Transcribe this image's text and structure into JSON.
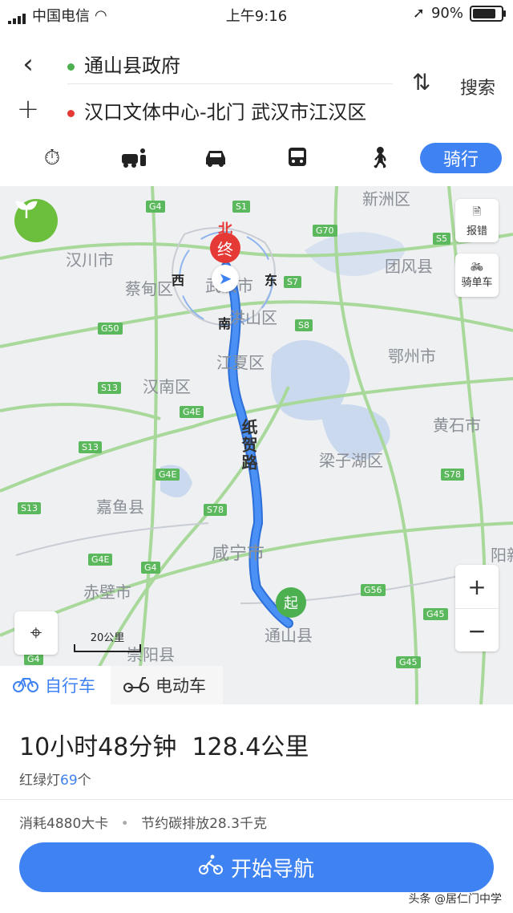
{
  "status_bar": {
    "carrier": "中国电信",
    "time": "上午9:16",
    "battery": "90%"
  },
  "route": {
    "origin": "通山县政府",
    "destination": "汉口文体中心-北门 武汉市江汉区",
    "search_label": "搜索"
  },
  "modes": [
    {
      "name": "taxi",
      "icon": "stopwatch-icon"
    },
    {
      "name": "ride-share",
      "icon": "car-people-icon"
    },
    {
      "name": "drive",
      "icon": "car-icon"
    },
    {
      "name": "bus",
      "icon": "bus-icon"
    },
    {
      "name": "walk",
      "icon": "walk-icon"
    },
    {
      "name": "cycle",
      "label": "骑行",
      "active": true
    }
  ],
  "map": {
    "labels": [
      "新洲区",
      "汉川市",
      "蔡甸区",
      "武汉市",
      "洪山区",
      "团风县",
      "鄂州市",
      "江夏区",
      "汉南区",
      "黄石市",
      "梁子湖区",
      "嘉鱼县",
      "咸宁市",
      "赤壁市",
      "崇阳县",
      "阳新",
      "通山县"
    ],
    "highways": [
      "G4",
      "S1",
      "G70",
      "S5",
      "S7",
      "G50",
      "S8",
      "S13",
      "G4E",
      "S13",
      "G4E",
      "S78",
      "S78",
      "S13",
      "G4E",
      "G4",
      "G56",
      "G45",
      "G45",
      "G4"
    ],
    "road_name": "纸贺路",
    "start_marker": "起",
    "end_marker": "终",
    "compass": {
      "north": "北",
      "south": "南",
      "east": "东",
      "west": "西"
    },
    "report_label": "报错",
    "bike_label": "骑单车",
    "scale_label": "20公里",
    "zoom_in": "+",
    "zoom_out": "−"
  },
  "tabs": [
    {
      "label": "自行车",
      "active": true
    },
    {
      "label": "电动车",
      "active": false
    }
  ],
  "summary": {
    "duration": "10小时48分钟",
    "distance": "128.4公里",
    "lights_prefix": "红绿灯",
    "lights_count": "69",
    "lights_suffix": "个",
    "calories": "消耗4880大卡",
    "carbon": "节约碳排放28.3千克",
    "start_nav": "开始导航"
  },
  "watermark": "头条 @居仁门中学",
  "colors": {
    "accent": "#3f82f1",
    "highway": "#5cb85c",
    "start": "#4caf50",
    "end": "#e53935"
  }
}
